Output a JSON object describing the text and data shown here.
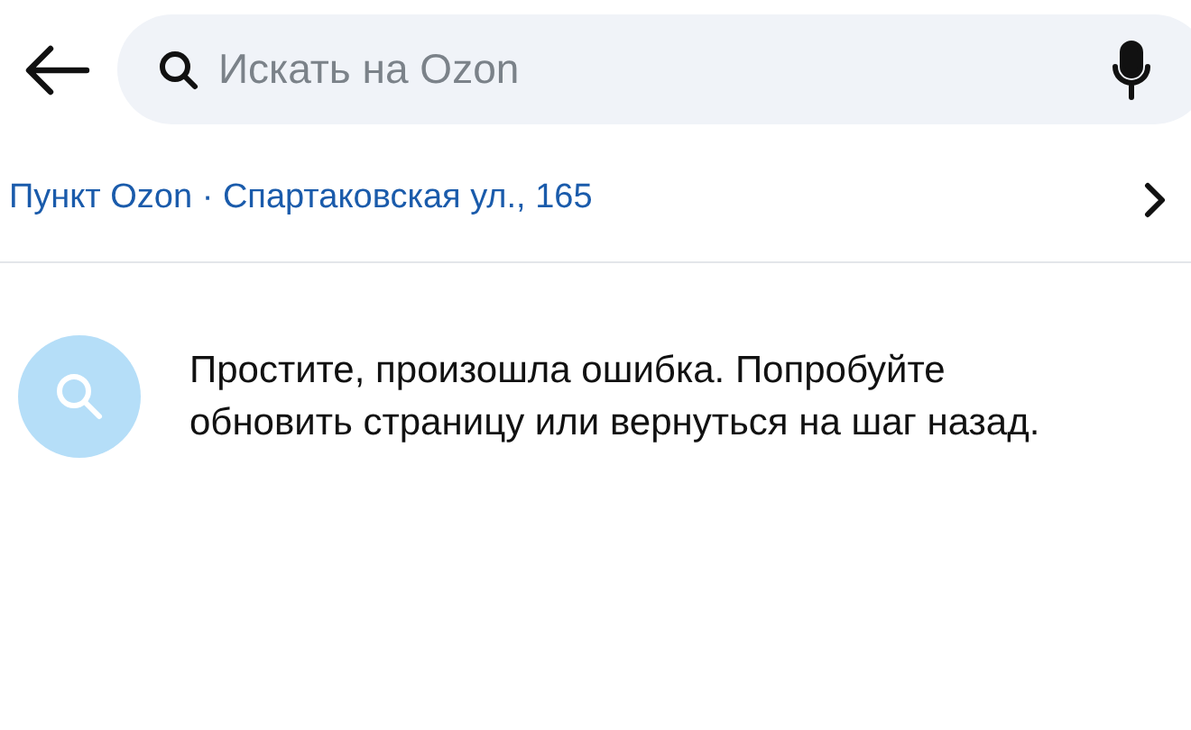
{
  "search": {
    "placeholder": "Искать на Ozon"
  },
  "pickup_point": {
    "label": "Пункт Ozon · Спартаковская ул., 165"
  },
  "error": {
    "message": "Простите, произошла ошибка. Попробуйте обновить страницу или вернуться на шаг назад."
  }
}
